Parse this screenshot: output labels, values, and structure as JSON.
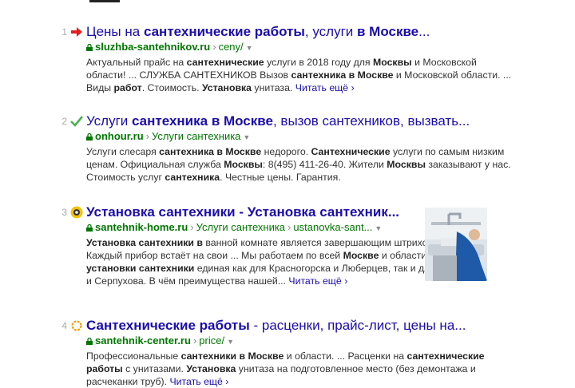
{
  "results": [
    {
      "num": "1",
      "title": [
        "Цены на ",
        "сантехнические работы",
        ", услуги ",
        "в Москве",
        "..."
      ],
      "domain": "sluzhba-santehnikov.ru",
      "path": [
        "ceny/"
      ],
      "snippet": [
        "Актуальный прайс на ",
        "сантехнические",
        " услуги в 2018 году для ",
        "Москвы",
        " и Московской области! ... СЛУЖБА САНТЕХНИКОВ Вызов ",
        "сантехника в Москве",
        " и Московской области. ... Виды ",
        "работ",
        ". Стоимость. ",
        "Установка",
        " унитаза."
      ],
      "more": "Читать ещё"
    },
    {
      "num": "2",
      "title": [
        "Услуги ",
        "сантехника в Москве",
        ", вызов сантехников, вызвать..."
      ],
      "domain": "onhour.ru",
      "path": [
        "Услуги сантехника"
      ],
      "snippet": [
        "Услуги слесаря ",
        "сантехника в Москве",
        " недорого. ",
        "Сантехнические",
        " услуги по самым низким ценам. Официальная служба ",
        "Москвы",
        ": 8(495) 411-26-40. Жители ",
        "Москвы",
        " заказывают у нас. Стоимость услуг ",
        "сантехника",
        ". Честные цены. Гарантия."
      ]
    },
    {
      "num": "3",
      "title": [
        "Установка сантехники - Установка сантехник..."
      ],
      "domain": "santehnik-home.ru",
      "path": [
        "Услуги сантехника",
        "ustanovka-sant..."
      ],
      "snippet": [
        "Установка сантехники в",
        " ванной комнате является завершающим штрихом в ремонте. Каждый прибор встаёт на свои ... Мы работаем по всей ",
        "Москве",
        " и области. Стоимость ",
        "установки сантехники",
        " единая как для Красногорска и Люберцев, так и для Подольска и Серпухова. В чём преимущества нашей..."
      ],
      "more": "Читать ещё"
    },
    {
      "num": "4",
      "title": [
        "Сантехнические работы",
        " - расценки, прайс-лист, цены на..."
      ],
      "domain": "santehnik-center.ru",
      "path": [
        "price/"
      ],
      "snippet": [
        "Профессиональные ",
        "сантехники в Москве",
        " и области. ... Расценки на ",
        "сантехнические работы",
        " с унитазами. ",
        "Установка",
        " унитаза на подготовленное место (без демонтажа и расчеканки труб)."
      ],
      "more": "Читать ещё"
    }
  ],
  "icons": {
    "r1": "red-arrow-icon",
    "r2": "green-checkmark-icon",
    "r3": "santehnik-home-logo-icon",
    "r4": "orange-ring-icon",
    "lock": "lock-icon",
    "more": "chevron-right-icon"
  },
  "colors": {
    "title": "#1a0dab",
    "url": "#007700",
    "arrow": "#e02020",
    "check": "#4caf50",
    "ring": "#f39c12"
  }
}
